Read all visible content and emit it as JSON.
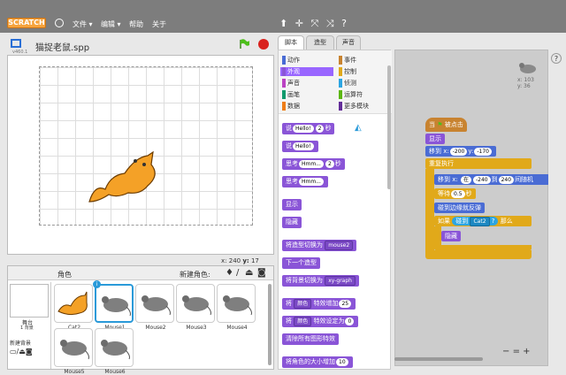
{
  "menubar": {
    "logo": "SCRATCH",
    "items": [
      "文件 ▾",
      "编辑 ▾",
      "帮助",
      "关于"
    ]
  },
  "toolbar": {
    "icons": [
      "⬆",
      "✛",
      "⤧",
      "⤨",
      "?"
    ]
  },
  "project": {
    "title": "猫捉老鼠.spp",
    "version": "v460.1"
  },
  "stage": {
    "coords_x_label": "x:",
    "coords_x": "240",
    "coords_y_label": "y:",
    "coords_y": "17"
  },
  "sprites_panel": {
    "title": "角色",
    "new_sprite": "新建角色:",
    "stage_label": "舞台",
    "stage_sub": "1 背景",
    "new_backdrop": "新建背景",
    "sprites": [
      "Cat2",
      "Mouse1",
      "Mouse2",
      "Mouse3",
      "Mouse4",
      "Mouse5",
      "Mouse6"
    ],
    "selected": "Mouse1"
  },
  "tabs": [
    "脚本",
    "造型",
    "声音"
  ],
  "categories": {
    "left": [
      "动作",
      "外观",
      "声音",
      "画笔",
      "数据"
    ],
    "right": [
      "事件",
      "控制",
      "侦测",
      "运算符",
      "更多模块"
    ],
    "selected": "外观"
  },
  "palette_blocks": {
    "say_secs": {
      "a": "说",
      "v": "Hello!",
      "n": "2",
      "b": "秒"
    },
    "say": {
      "a": "说",
      "v": "Hello!"
    },
    "think_secs": {
      "a": "思考",
      "v": "Hmm...",
      "n": "2",
      "b": "秒"
    },
    "think": {
      "a": "思考",
      "v": "Hmm..."
    },
    "show": "显示",
    "hide": "隐藏",
    "switch_costume": {
      "a": "将造型切换为",
      "v": "mouse2"
    },
    "next_costume": "下一个造型",
    "switch_backdrop": {
      "a": "将背景切换为",
      "v": "xy-graph"
    },
    "change_effect": {
      "a": "将",
      "v": "颜色",
      "b": "特效增加",
      "n": "25"
    },
    "set_effect": {
      "a": "将",
      "v": "颜色",
      "b": "特效设定为",
      "n": "0"
    },
    "clear_effects": "清除所有图形特效",
    "change_size": {
      "a": "将角色的大小增加",
      "n": "10"
    }
  },
  "script": {
    "hat": {
      "a": "当",
      "b": "被点击"
    },
    "show": "显示",
    "goto": {
      "a": "移到 x:",
      "x": "-200",
      "b": "y:",
      "y": "-170"
    },
    "forever": "重复执行",
    "glide": {
      "a": "移到 x:",
      "b": "在",
      "v1": "-240",
      "c": "到",
      "v2": "240",
      "d": "间随机"
    },
    "wait": {
      "a": "等待",
      "n": "0.5",
      "b": "秒"
    },
    "bounce": "碰到边缘就反弹",
    "if": {
      "a": "如果",
      "b": "碰到",
      "v": "Cat2",
      "c": "?",
      "d": "那么"
    },
    "hide": "隐藏"
  },
  "sprite_info": {
    "x": "x: 103",
    "y": "y: 36"
  },
  "zoom": [
    "−",
    "=",
    "+"
  ],
  "colors": {
    "looks": "#8a55d7",
    "motion": "#4a6cd4",
    "event": "#c88330",
    "control": "#e1a91a",
    "sensing": "#2ca5e2"
  }
}
